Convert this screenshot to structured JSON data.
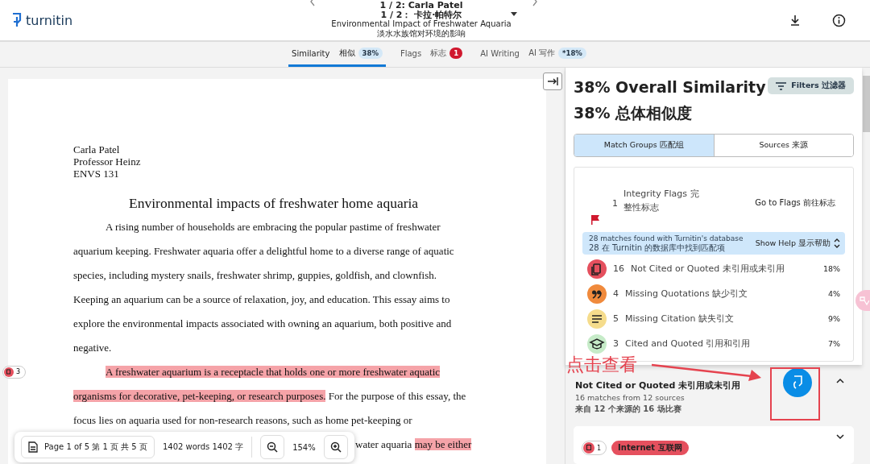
{
  "header": {
    "logo": "turnitin",
    "submission": "1 / 2: Carla Patel",
    "submission_zh": "1 / 2：  卡拉·帕特尔",
    "title": "Environmental Impact of Freshwater Aquaria",
    "title_zh": "淡水水族馆对环境的影响"
  },
  "tabs": [
    {
      "label": "Similarity",
      "label_zh": "相似",
      "badge": "38%",
      "kind": "percent",
      "selected": true
    },
    {
      "label": "Flags",
      "label_zh": "标志",
      "badge": "1",
      "kind": "alert",
      "selected": false
    },
    {
      "label": "AI Writing",
      "label_zh": "AI 写作",
      "badge": "*18%",
      "kind": "percent",
      "selected": false
    }
  ],
  "document": {
    "heading_lines": [
      "Carla Patel",
      "Professor Heinz",
      "ENVS 131"
    ],
    "title": "Environmental impacts of freshwater home aquaria",
    "lines": [
      {
        "kind": "first",
        "segments": [
          {
            "text": "A rising number of households are embracing the popular pastime of freshwater",
            "highlighted": false
          }
        ]
      },
      {
        "kind": "body",
        "segments": [
          {
            "text": "aquarium keeping. Freshwater aquaria offer a delightful home to a diverse range of aquatic",
            "highlighted": false
          }
        ]
      },
      {
        "kind": "body",
        "segments": [
          {
            "text": "species, including mystery snails, freshwater shrimp, guppies, goldfish, and clownfish.",
            "highlighted": false
          }
        ]
      },
      {
        "kind": "body",
        "segments": [
          {
            "text": "Keeping an aquarium can be a source of relaxation, joy, and education. This essay aims to",
            "highlighted": false
          }
        ]
      },
      {
        "kind": "body",
        "segments": [
          {
            "text": "explore the environmental impacts associated with owning an aquarium, both positive and",
            "highlighted": false
          }
        ]
      },
      {
        "kind": "body",
        "segments": [
          {
            "text": "negative.",
            "highlighted": false
          }
        ]
      },
      {
        "kind": "first",
        "marker": "3",
        "segments": [
          {
            "text": "A freshwater aquarium is a receptacle that holds one or more freshwater aquatic",
            "highlighted": true
          }
        ]
      },
      {
        "kind": "body",
        "segments": [
          {
            "text": "organisms for decorative, pet-keeping, or research purposes.",
            "highlighted": true
          },
          {
            "text": " For the purpose of this essay, the",
            "highlighted": false
          }
        ]
      },
      {
        "kind": "body",
        "segments": [
          {
            "text": "focus lies on aquaria used for non-research reasons, such as home pet-keeping or",
            "highlighted": false
          }
        ]
      },
      {
        "kind": "tail",
        "segments": [
          {
            "text": "water aquaria ",
            "highlighted": false
          },
          {
            "text": "may be either",
            "highlighted": true
          }
        ]
      }
    ]
  },
  "toolbar": {
    "page": "Page 1 of 5  第 1 页 共 5 页",
    "words": "1402 words  1402 字",
    "zoom": "154%"
  },
  "panel": {
    "title": "38% Overall Similarity",
    "title_zh": "38% 总体相似度",
    "filters": "Filters  过滤器",
    "view_toggle": [
      {
        "label": "Match Groups  匹配组",
        "selected": true
      },
      {
        "label": "Sources  来源",
        "selected": false
      }
    ],
    "flags": {
      "count": "1",
      "label": "Integrity Flags  完整性标志",
      "link": "Go to Flags  前往标志"
    },
    "help": {
      "text": "28 matches found with Turnitin's database",
      "text_zh": "28 在 Turnitin 的数据库中找到匹配项",
      "button": "Show Help  显示帮助"
    },
    "categories": [
      {
        "kind": "not_cited",
        "count": "16",
        "label": "Not Cited or Quoted  未引用或未引用",
        "percent": "18%",
        "color": "#e5505e"
      },
      {
        "kind": "missing_quotations",
        "count": "4",
        "label": "Missing Quotations  缺少引文",
        "percent": "4%",
        "color": "#f08a3c"
      },
      {
        "kind": "missing_citation",
        "count": "5",
        "label": "Missing Citation  缺失引文",
        "percent": "9%",
        "color": "#f5dc8c"
      },
      {
        "kind": "cited",
        "count": "3",
        "label": "Cited and Quoted  引用和引用",
        "percent": "7%",
        "color": "#c6ebc8"
      }
    ],
    "group": {
      "title": "Not Cited or Quoted  未引用或未引用",
      "summary": "16 matches from 12 sources",
      "summary_zh": "来自 12 个来源的 16 场比赛",
      "expanded": true
    },
    "source": {
      "count": "1",
      "tag": "Internet  互联网"
    }
  },
  "annotation": {
    "text": "点击查看"
  }
}
